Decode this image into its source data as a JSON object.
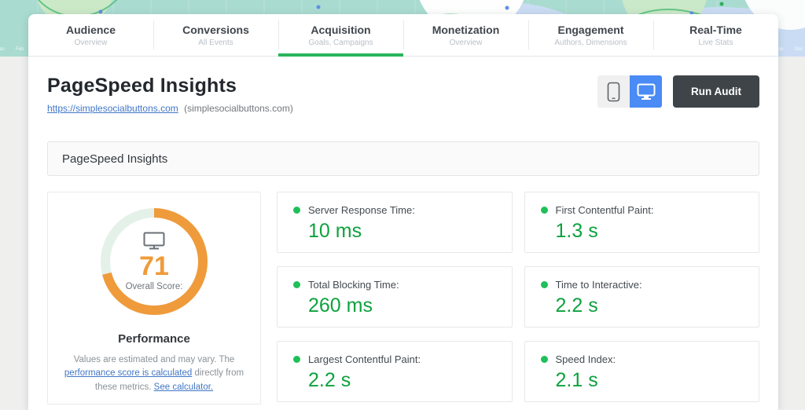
{
  "background": {
    "axis_labels": [
      "Jan",
      "Feb",
      "Nov",
      "Dec"
    ]
  },
  "nav": {
    "tabs": [
      {
        "label": "Audience",
        "sublabel": "Overview",
        "active": false
      },
      {
        "label": "Conversions",
        "sublabel": "All Events",
        "active": false
      },
      {
        "label": "Acquisition",
        "sublabel": "Goals, Campaigns",
        "active": true
      },
      {
        "label": "Monetization",
        "sublabel": "Overview",
        "active": false
      },
      {
        "label": "Engagement",
        "sublabel": "Authors, Dimensions",
        "active": false
      },
      {
        "label": "Real-Time",
        "sublabel": "Live Stats",
        "active": false
      }
    ]
  },
  "header": {
    "title": "PageSpeed Insights",
    "url_link": "https://simplesocialbuttons.com",
    "url_suffix": "(simplesocialbuttons.com)",
    "run_audit_label": "Run Audit",
    "device_toggle_active": "desktop"
  },
  "panel": {
    "title": "PageSpeed Insights"
  },
  "gauge": {
    "score": 71,
    "score_label": "Overall Score:",
    "category": "Performance",
    "disclaimer": {
      "text1": "Values are estimated and may vary. The ",
      "link1": "performance score is calculated",
      "text2": " directly from these metrics. ",
      "link2": "See calculator."
    }
  },
  "metrics": [
    {
      "label": "Server Response Time:",
      "value": "10 ms"
    },
    {
      "label": "First Contentful Paint:",
      "value": "1.3 s"
    },
    {
      "label": "Total Blocking Time:",
      "value": "260 ms"
    },
    {
      "label": "Time to Interactive:",
      "value": "2.2 s"
    },
    {
      "label": "Largest Contentful Paint:",
      "value": "2.2 s"
    },
    {
      "label": "Speed Index:",
      "value": "2.1 s"
    }
  ],
  "colors": {
    "active_tab_green": "#2ab55b",
    "metric_value_green": "#0da23e",
    "metric_dot_green": "#1fbf59",
    "score_orange": "#ef9b3b",
    "gauge_track_mint": "#e4f1e9",
    "link_blue": "#4176c6",
    "toggle_active_blue": "#4a8bf5",
    "run_audit_dark": "#3f4449",
    "background_teal": "#aadbd0"
  }
}
